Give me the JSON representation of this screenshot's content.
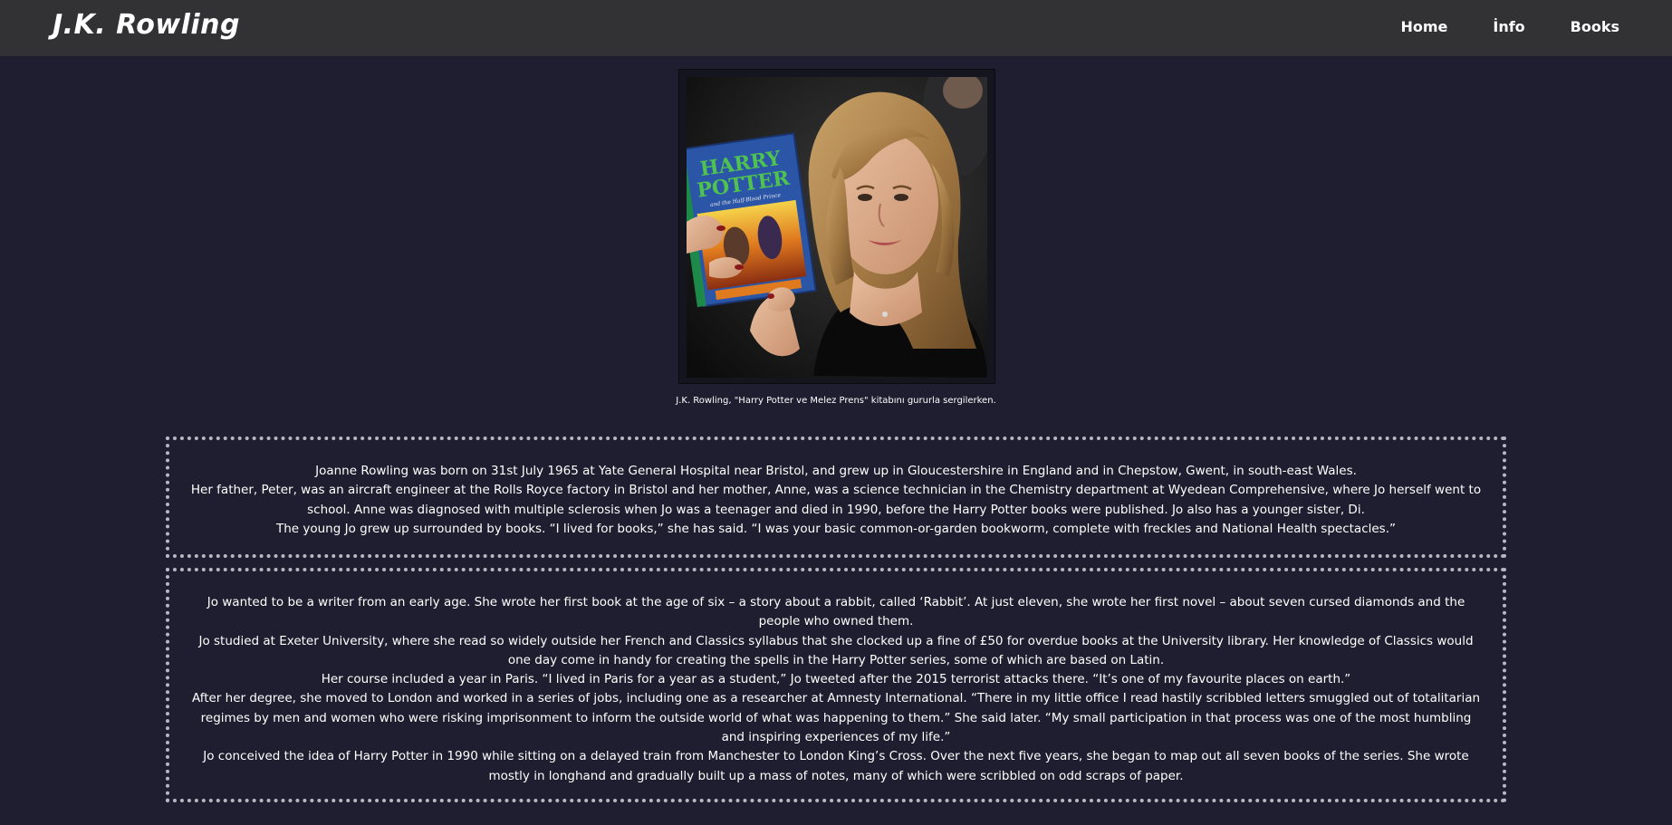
{
  "navbar": {
    "brand": "J.K. Rowling",
    "links": [
      "Home",
      "İnfo",
      "Books"
    ]
  },
  "photo": {
    "caption": "J.K. Rowling, \"Harry Potter ve Melez Prens\" kitabını gururla sergilerken.",
    "book_title_line1": "HARRY",
    "book_title_line2": "POTTER",
    "book_subtitle": "and the Half-Blood Prince"
  },
  "section1": {
    "paragraphs": [
      "Joanne Rowling was born on 31st July 1965 at Yate General Hospital near Bristol, and grew up in Gloucestershire in England and in Chepstow, Gwent, in south-east Wales.",
      "Her father, Peter, was an aircraft engineer at the Rolls Royce factory in Bristol and her mother, Anne, was a science technician in the Chemistry department at Wyedean Comprehensive, where Jo herself went to school. Anne was diagnosed with multiple sclerosis when Jo was a teenager and died in 1990, before the Harry Potter books were published. Jo also has a younger sister, Di.",
      "The young Jo grew up surrounded by books. “I lived for books,” she has said. “I was your basic common-or-garden bookworm, complete with freckles and National Health spectacles.”"
    ]
  },
  "section2": {
    "paragraphs": [
      "Jo wanted to be a writer from an early age. She wrote her first book at the age of six – a story about a rabbit, called ‘Rabbit’. At just eleven, she wrote her first novel – about seven cursed diamonds and the people who owned them.",
      "Jo studied at Exeter University, where she read so widely outside her French and Classics syllabus that she clocked up a fine of £50 for overdue books at the University library. Her knowledge of Classics would one day come in handy for creating the spells in the Harry Potter series, some of which are based on Latin.",
      "Her course included a year in Paris. “I lived in Paris for a year as a student,” Jo tweeted after the 2015 terrorist attacks there. “It’s one of my favourite places on earth.”",
      "After her degree, she moved to London and worked in a series of jobs, including one as a researcher at Amnesty International. “There in my little office I read hastily scribbled letters smuggled out of totalitarian regimes by men and women who were risking imprisonment to inform the outside world of what was happening to them.” She said later. “My small participation in that process was one of the most humbling and inspiring experiences of my life.”",
      "Jo conceived the idea of Harry Potter in 1990 while sitting on a delayed train from Manchester to London King’s Cross. Over the next five years, she began to map out all seven books of the series. She wrote mostly in longhand and gradually built up a mass of notes, many of which were scribbled on odd scraps of paper."
    ]
  },
  "colors": {
    "page_background": "#1e1e30",
    "navbar_background": "#323235",
    "text": "#ffffff",
    "dotted_border": "#b8b8c4"
  }
}
